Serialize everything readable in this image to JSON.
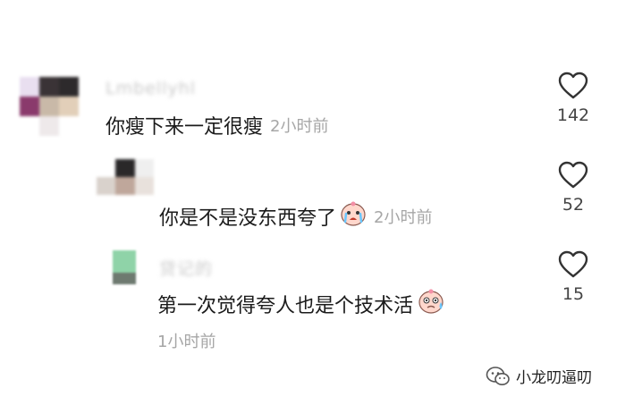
{
  "comments": [
    {
      "username": "Lmbellyhl",
      "text": "你瘦下来一定很瘦",
      "time": "2小时前",
      "likes": "142"
    },
    {
      "username": "",
      "text": "你是不是没东西夸了",
      "emoji": "crying-face-emoji",
      "time": "2小时前",
      "likes": "52"
    },
    {
      "username": "贷记的",
      "text": "第一次觉得夸人也是个技术活",
      "emoji": "sweat-face-emoji",
      "time": "1小时前",
      "likes": "15"
    }
  ],
  "watermark": {
    "icon": "wechat-icon",
    "text": "小龙叨逼叨"
  }
}
